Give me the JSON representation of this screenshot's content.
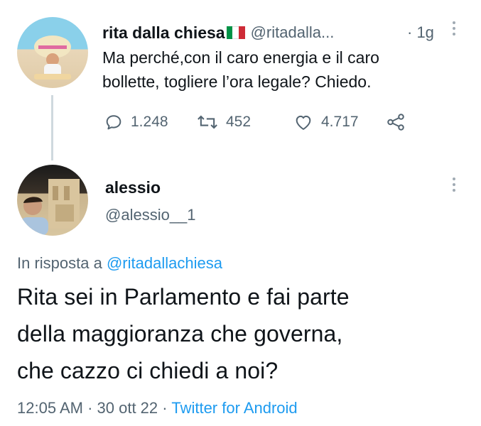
{
  "tweet": {
    "author_name": "rita dalla chiesa",
    "flag": "🇮🇹",
    "handle": "@ritadalla...",
    "time": "· 1g",
    "text_line1": "Ma perché,con il caro energia e il caro",
    "text_line2": "bollette, togliere l’ora legale? Chiedo.",
    "replies": "1.248",
    "retweets": "452",
    "likes": "4.717"
  },
  "reply": {
    "author_name": "alessio",
    "handle": "@alessio__1",
    "reply_to_prefix": "In risposta a",
    "reply_to_handle": "@ritadallachiesa",
    "text_line1": "Rita sei in Parlamento e fai parte",
    "text_line2": "della maggioranza che governa,",
    "text_line3": "che cazzo ci chiedi a noi?",
    "time": "12:05 AM",
    "date": "30 ott 22",
    "source": "Twitter for Android"
  },
  "colors": {
    "accent": "#1d9bf0",
    "muted": "#536471",
    "text": "#0f1419"
  },
  "icons": [
    "reply-icon",
    "retweet-icon",
    "like-icon",
    "share-icon",
    "more-icon"
  ]
}
